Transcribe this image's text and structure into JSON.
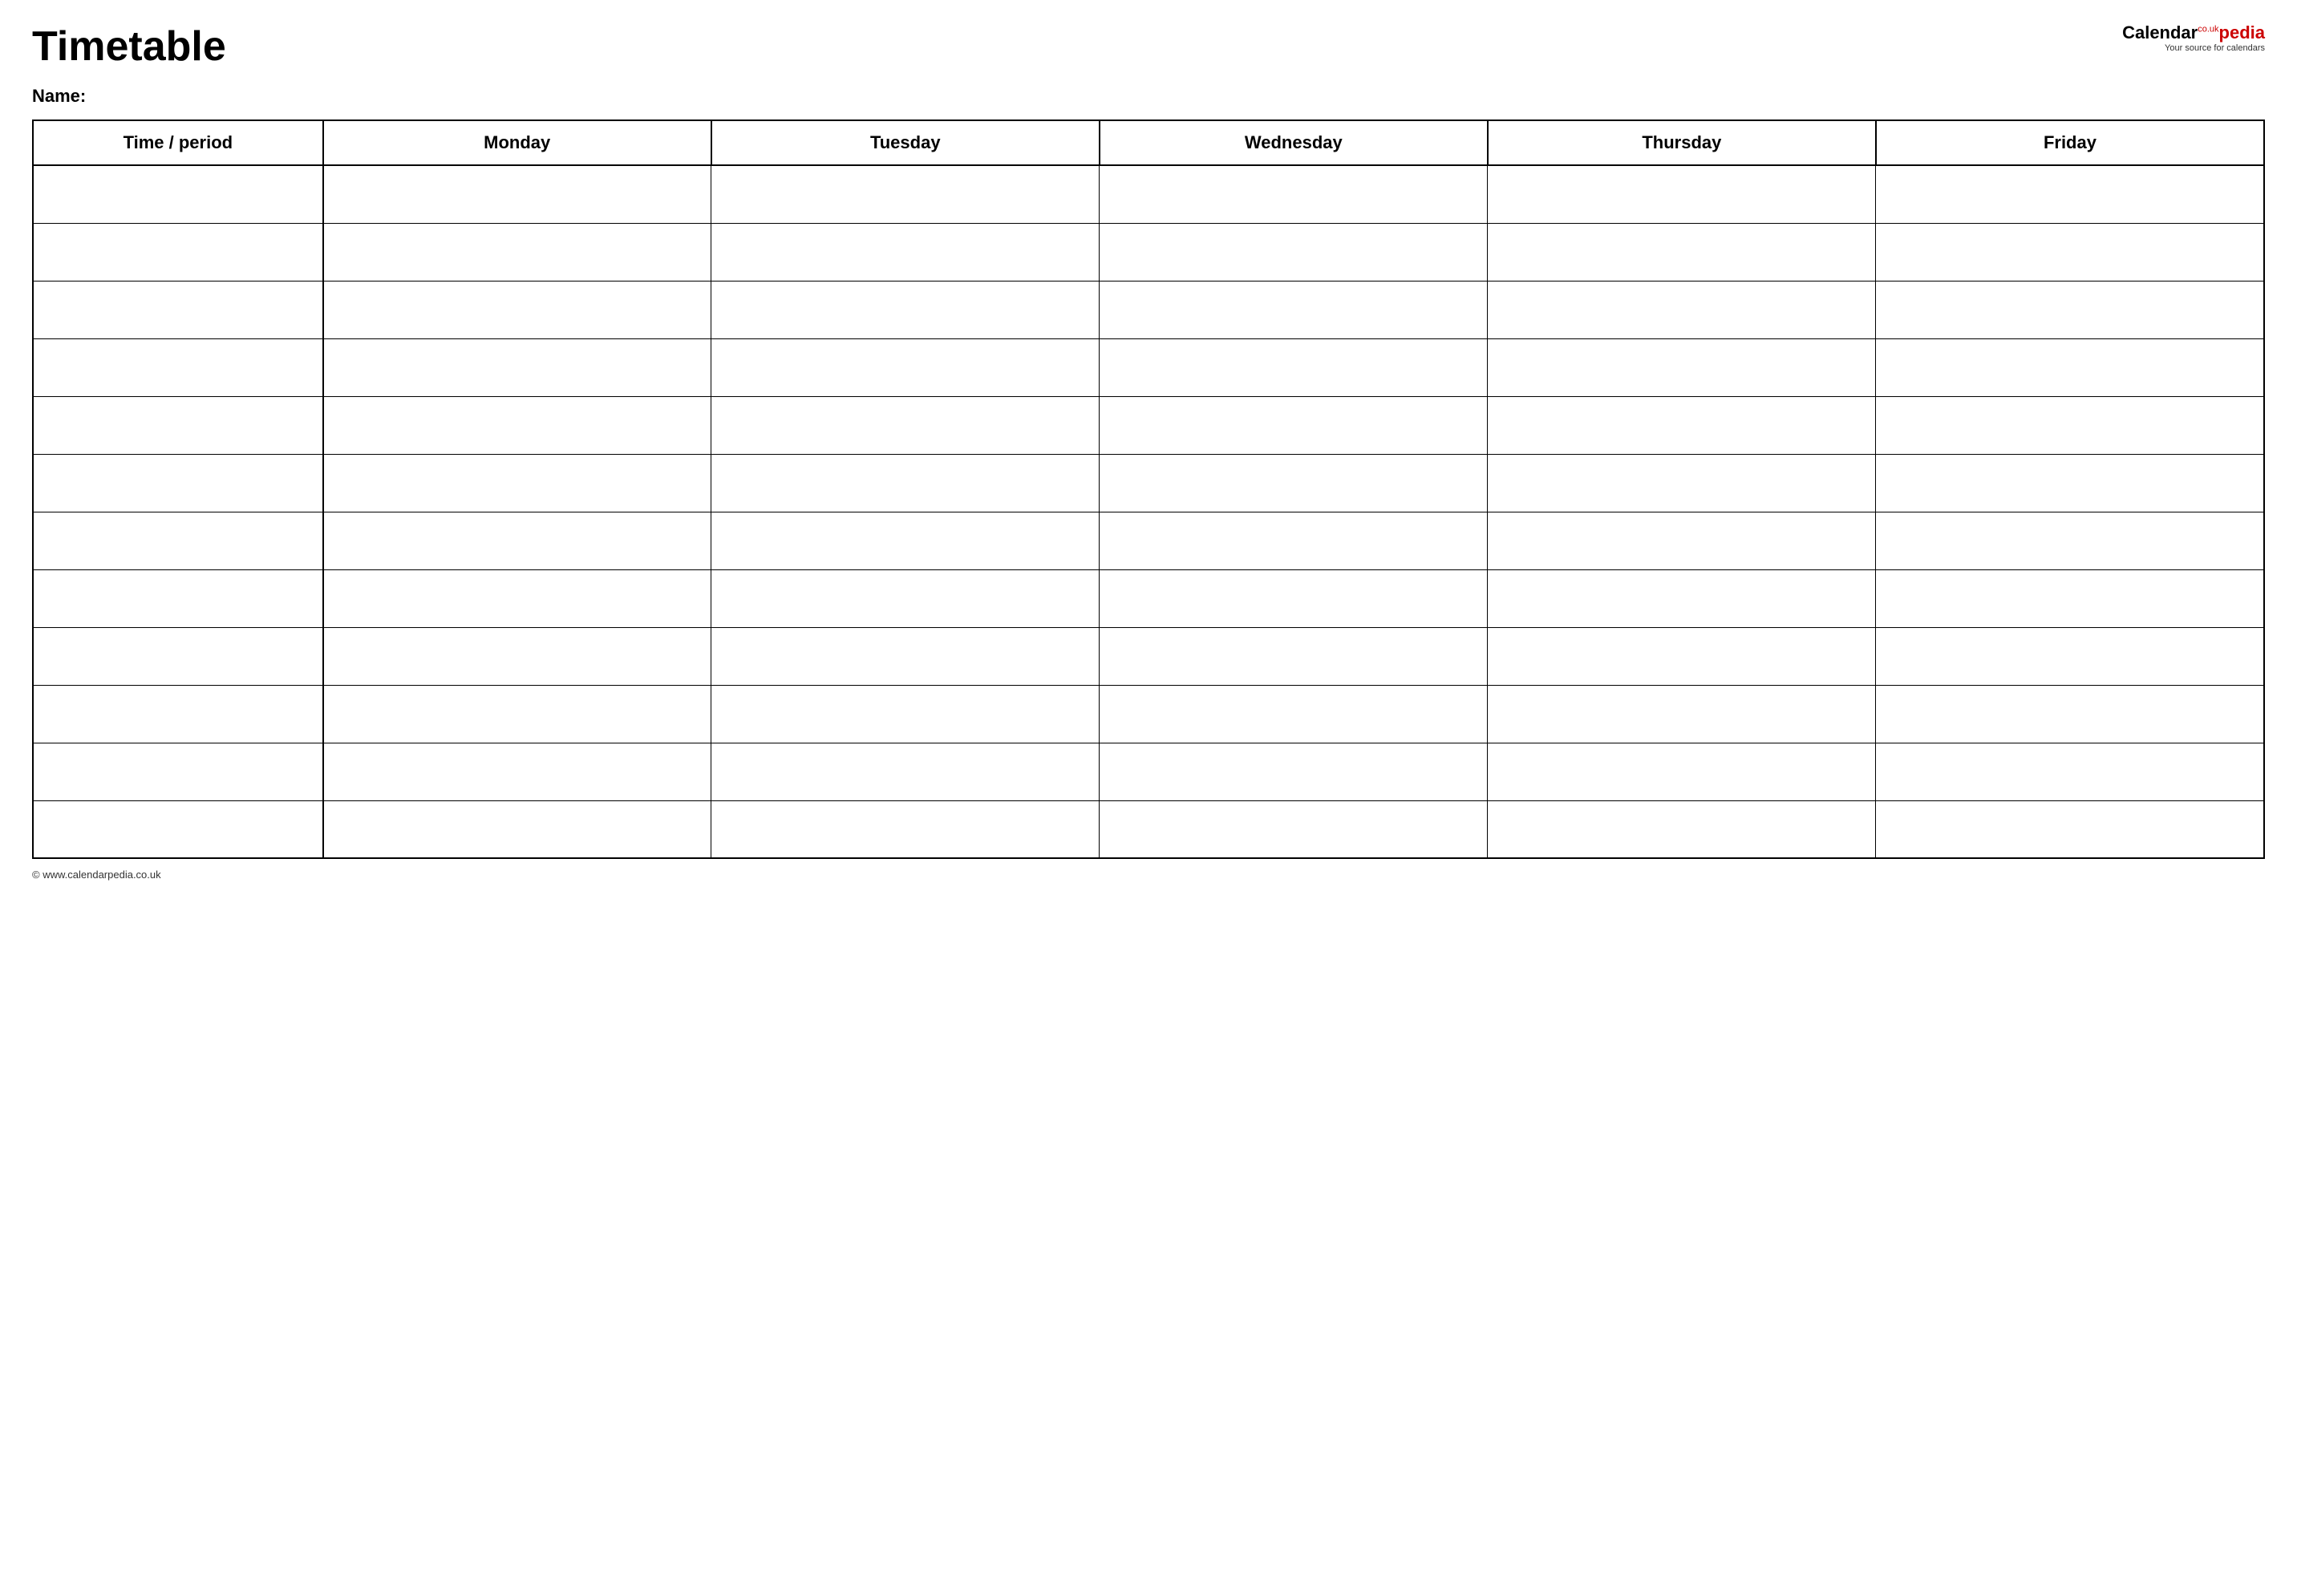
{
  "header": {
    "title": "Timetable",
    "logo": {
      "calendar": "Calendar",
      "pedia": "pedia",
      "co_uk": "co.uk",
      "subtitle": "Your source for calendars"
    }
  },
  "name_label": "Name:",
  "table": {
    "columns": [
      "Time / period",
      "Monday",
      "Tuesday",
      "Wednesday",
      "Thursday",
      "Friday"
    ],
    "row_count": 12
  },
  "footer": {
    "url": "www.calendarpedia.co.uk"
  }
}
